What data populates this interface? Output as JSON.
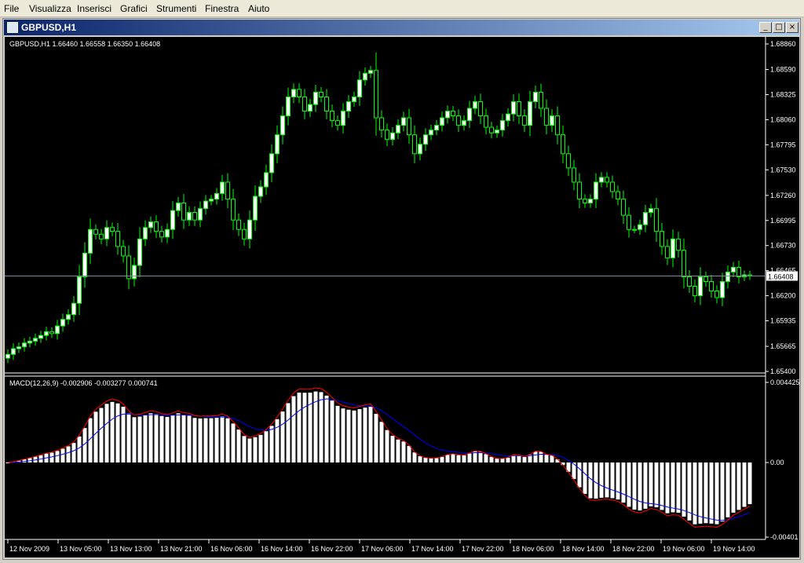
{
  "menu": [
    "File",
    "Visualizza",
    "Inserisci",
    "Grafici",
    "Strumenti",
    "Finestra",
    "Aiuto"
  ],
  "window": {
    "title": "GBPUSD,H1",
    "btn_min": "_",
    "btn_max": "□",
    "btn_close": "×"
  },
  "main_panel": {
    "label": "GBPUSD,H1  1.66460 1.66558 1.66350 1.66408",
    "price_ticks": [
      "1.68860",
      "1.68590",
      "1.68325",
      "1.68060",
      "1.67795",
      "1.67530",
      "1.67260",
      "1.66995",
      "1.66730",
      "1.66465",
      "1.66200",
      "1.65935",
      "1.65665",
      "1.65400"
    ],
    "current_price": "1.66408"
  },
  "macd_panel": {
    "label": "MACD(12,26,9) -0.002906 -0.003277 0.000741",
    "ticks": [
      "0.004425",
      "0.00",
      "-0.00401"
    ]
  },
  "time_axis": [
    "12 Nov 2009",
    "13 Nov 05:00",
    "13 Nov 13:00",
    "13 Nov 21:00",
    "16 Nov 06:00",
    "16 Nov 14:00",
    "16 Nov 22:00",
    "17 Nov 06:00",
    "17 Nov 14:00",
    "17 Nov 22:00",
    "18 Nov 06:00",
    "18 Nov 14:00",
    "18 Nov 22:00",
    "19 Nov 06:00",
    "19 Nov 14:00"
  ],
  "colors": {
    "candle": "#00ff00",
    "bull_body": "#ffffff",
    "signal_line": "#ff0000",
    "macd_blue": "#0000ff",
    "hist": "#ffffff",
    "grid_line": "#7f8ca0"
  },
  "chart_data": {
    "type": "candlestick",
    "ylim": [
      1.654,
      1.6886
    ],
    "closes": [
      1.6558,
      1.6564,
      1.6566,
      1.657,
      1.6572,
      1.6575,
      1.6578,
      1.6582,
      1.658,
      1.6588,
      1.6595,
      1.66,
      1.6612,
      1.664,
      1.6665,
      1.669,
      1.6685,
      1.668,
      1.6692,
      1.6688,
      1.6672,
      1.6662,
      1.6638,
      1.6652,
      1.668,
      1.6692,
      1.6698,
      1.6688,
      1.6682,
      1.669,
      1.671,
      1.6718,
      1.67,
      1.6708,
      1.67,
      1.6712,
      1.672,
      1.6722,
      1.6728,
      1.674,
      1.6722,
      1.67,
      1.669,
      1.668,
      1.67,
      1.6725,
      1.6735,
      1.675,
      1.677,
      1.679,
      1.681,
      1.683,
      1.6838,
      1.683,
      1.6815,
      1.6822,
      1.6835,
      1.683,
      1.6815,
      1.6805,
      1.68,
      1.6815,
      1.6825,
      1.683,
      1.6848,
      1.6855,
      1.6858,
      1.6808,
      1.6795,
      1.6785,
      1.6792,
      1.68,
      1.6808,
      1.679,
      1.677,
      1.678,
      1.679,
      1.6795,
      1.68,
      1.6808,
      1.6815,
      1.681,
      1.68,
      1.6805,
      1.6818,
      1.6825,
      1.681,
      1.6798,
      1.6792,
      1.6795,
      1.6805,
      1.6812,
      1.6825,
      1.681,
      1.68,
      1.6825,
      1.6835,
      1.6818,
      1.68,
      1.681,
      1.679,
      1.677,
      1.6755,
      1.674,
      1.6722,
      1.6718,
      1.6722,
      1.674,
      1.6745,
      1.674,
      1.673,
      1.6722,
      1.6705,
      1.669,
      1.669,
      1.6695,
      1.6708,
      1.6712,
      1.6688,
      1.6672,
      1.666,
      1.668,
      1.6668,
      1.664,
      1.663,
      1.662,
      1.664,
      1.6635,
      1.6625,
      1.6618,
      1.6635,
      1.6645,
      1.665,
      1.664,
      1.6642,
      1.6641
    ]
  }
}
